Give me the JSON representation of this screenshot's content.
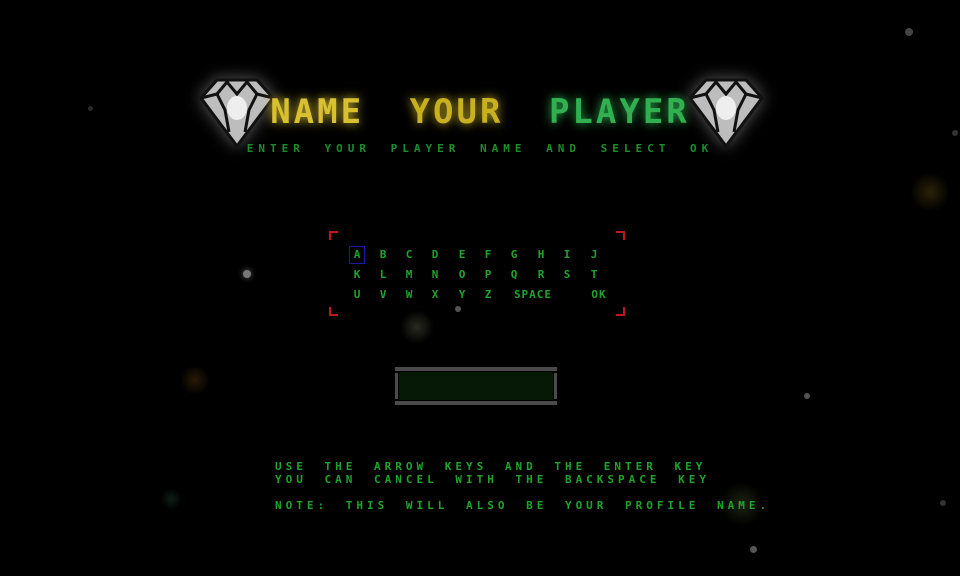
{
  "screen": "name-entry",
  "title": {
    "words": [
      {
        "text": "NAME",
        "color": "#d8c030"
      },
      {
        "text": "YOUR",
        "color": "#c8b020"
      },
      {
        "text": "PLAYER",
        "color": "#30b050"
      }
    ]
  },
  "subtitle": "ENTER YOUR PLAYER NAME AND SELECT OK",
  "keyboard": {
    "selected": "A",
    "rows": [
      [
        "A",
        "B",
        "C",
        "D",
        "E",
        "F",
        "G",
        "H",
        "I",
        "J"
      ],
      [
        "K",
        "L",
        "M",
        "N",
        "O",
        "P",
        "Q",
        "R",
        "S",
        "T"
      ],
      [
        "U",
        "V",
        "W",
        "X",
        "Y",
        "Z",
        "SPACE",
        "OK"
      ]
    ]
  },
  "name_input": {
    "value": "",
    "placeholder": ""
  },
  "instructions": {
    "line1": "USE THE ARROW KEYS AND THE ENTER KEY",
    "line2": "YOU CAN CANCEL WITH THE BACKSPACE KEY",
    "note": "NOTE: THIS WILL ALSO BE YOUR PROFILE NAME."
  },
  "colors": {
    "text_green": "#1ea32c",
    "selection": "#1a1aa8",
    "frame_corner": "#c01818",
    "input_bg": "#061806"
  }
}
